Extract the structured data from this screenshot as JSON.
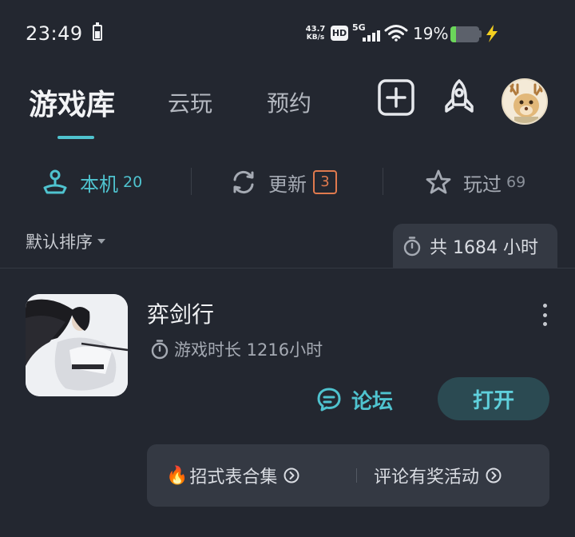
{
  "status_bar": {
    "time": "23:49",
    "net_speed_value": "43.7",
    "net_speed_unit": "KB/s",
    "hd_label": "HD",
    "signal_label": "5G",
    "battery_percent": "19%",
    "battery_level": 0.19
  },
  "header": {
    "tabs": [
      {
        "label": "游戏库",
        "active": true
      },
      {
        "label": "云玩",
        "active": false
      },
      {
        "label": "预约",
        "active": false
      }
    ]
  },
  "sub_tabs": [
    {
      "label": "本机",
      "count": "20",
      "active": true
    },
    {
      "label": "更新",
      "count": "3",
      "active": false
    },
    {
      "label": "玩过",
      "count": "69",
      "active": false
    }
  ],
  "sort": {
    "label": "默认排序"
  },
  "total_time": {
    "label": "共 1684 小时"
  },
  "game": {
    "title": "弈剑行",
    "playtime": "游戏时长 1216小时",
    "forum_label": "论坛",
    "open_label": "打开",
    "activities": [
      {
        "label": "招式表合集"
      },
      {
        "label": "评论有奖活动"
      }
    ]
  },
  "colors": {
    "background": "#232730",
    "accent": "#4fc3cf",
    "badge": "#e07a4e",
    "battery": "#6bd65a"
  }
}
